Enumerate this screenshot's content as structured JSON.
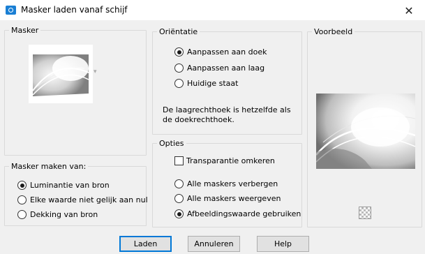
{
  "window": {
    "title": "Masker laden vanaf schijf",
    "close_glyph": "✕"
  },
  "masker_group": {
    "legend": "Masker",
    "dropdown_arrow": "▾"
  },
  "maken_group": {
    "legend": "Masker maken van:",
    "options": [
      {
        "label": "Luminantie van bron",
        "selected": true
      },
      {
        "label": "Elke waarde niet gelijk aan nul",
        "selected": false
      },
      {
        "label": "Dekking van bron",
        "selected": false
      }
    ]
  },
  "orientatie_group": {
    "legend": "Oriëntatie",
    "options": [
      {
        "label": "Aanpassen aan doek",
        "selected": true
      },
      {
        "label": "Aanpassen aan laag",
        "selected": false
      },
      {
        "label": "Huidige staat",
        "selected": false
      }
    ],
    "info_line1": "De laagrechthoek is hetzelfde als",
    "info_line2": "de doekrechthoek."
  },
  "opties_group": {
    "legend": "Opties",
    "invert_label": "Transparantie omkeren",
    "invert_checked": false,
    "options": [
      {
        "label": "Alle maskers verbergen",
        "selected": false
      },
      {
        "label": "Alle maskers weergeven",
        "selected": false
      },
      {
        "label": "Afbeeldingswaarde gebruiken",
        "selected": true
      }
    ]
  },
  "preview_group": {
    "legend": "Voorbeeld"
  },
  "buttons": {
    "load": "Laden",
    "cancel": "Annuleren",
    "help": "Help"
  },
  "colors": {
    "accent": "#0078d7",
    "dialog_bg": "#f0f0f0"
  }
}
